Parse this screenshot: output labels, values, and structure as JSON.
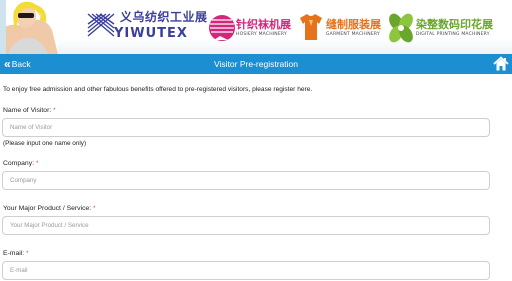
{
  "banner": {
    "yiwutex": {
      "cn": "义乌纺织工业展",
      "en": "YIWUTEX"
    },
    "exhibitions": [
      {
        "tiny": "",
        "cn": "针织袜机展",
        "en": "HOSIERY MACHINERY",
        "color": "#d4267d"
      },
      {
        "tiny": "",
        "cn": "缝制服装展",
        "en": "GARMENT MACHINERY",
        "color": "#e6731c"
      },
      {
        "tiny": "",
        "cn": "染整数码印花展",
        "en": "DIGITAL PRINTING MACHINERY",
        "color": "#6aa52c"
      }
    ]
  },
  "nav": {
    "back_label": "Back",
    "title": "Visitor Pre-registration",
    "accent": "#1c8fd3"
  },
  "form": {
    "intro": "To enjoy free admission and other fabulous benefits offered to pre-registered visitors, please register here.",
    "required_mark": "*",
    "fields": [
      {
        "label": "Name of Visitor:",
        "placeholder": "Name of Visitor",
        "hint": "(Please input one name only)"
      },
      {
        "label": "Company:",
        "placeholder": "Company"
      },
      {
        "label": "Your Major Product / Service:",
        "placeholder": "Your Major Product / Service"
      },
      {
        "label": "E-mail:",
        "placeholder": "E-mail"
      }
    ]
  }
}
